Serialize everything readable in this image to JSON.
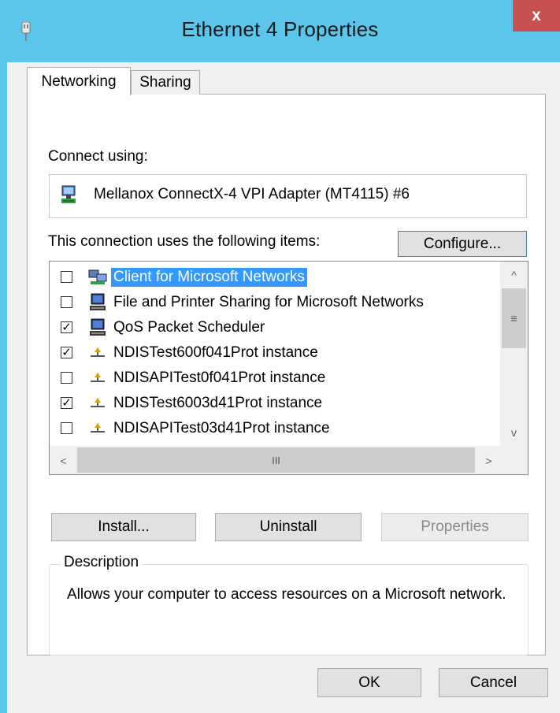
{
  "window": {
    "title": "Ethernet 4 Properties",
    "close_label": "x"
  },
  "tabs": [
    {
      "label": "Networking",
      "active": true
    },
    {
      "label": "Sharing",
      "active": false
    }
  ],
  "connect_using": {
    "label": "Connect using:",
    "adapter_name": "Mellanox ConnectX-4 VPI Adapter (MT4115) #6",
    "configure_label": "Configure..."
  },
  "items_section": {
    "label": "This connection uses the following items:",
    "items": [
      {
        "label": "Client for Microsoft Networks",
        "checked": false,
        "selected": true,
        "icon": "client-network-icon"
      },
      {
        "label": "File and Printer Sharing for Microsoft Networks",
        "checked": false,
        "selected": false,
        "icon": "service-computer-icon"
      },
      {
        "label": "QoS Packet Scheduler",
        "checked": true,
        "selected": false,
        "icon": "service-computer-icon"
      },
      {
        "label": "NDISTest600f041Prot instance",
        "checked": true,
        "selected": false,
        "icon": "protocol-icon"
      },
      {
        "label": "NDISAPITest0f041Prot instance",
        "checked": false,
        "selected": false,
        "icon": "protocol-icon"
      },
      {
        "label": "NDISTest6003d41Prot instance",
        "checked": true,
        "selected": false,
        "icon": "protocol-icon"
      },
      {
        "label": "NDISAPITest03d41Prot instance",
        "checked": false,
        "selected": false,
        "icon": "protocol-icon"
      }
    ]
  },
  "scrollbar": {
    "up": "^",
    "down": "v",
    "left": "<",
    "right": ">",
    "v_grip": "≡",
    "h_grip": "III"
  },
  "actions": {
    "install": "Install...",
    "uninstall": "Uninstall",
    "properties": "Properties"
  },
  "description": {
    "legend": "Description",
    "text": "Allows your computer to access resources on a Microsoft network."
  },
  "footer": {
    "ok": "OK",
    "cancel": "Cancel"
  },
  "colors": {
    "title_bar": "#5bc5ea",
    "close": "#c75050",
    "selection": "#3399ff",
    "dialog": "#f0f0f0"
  }
}
